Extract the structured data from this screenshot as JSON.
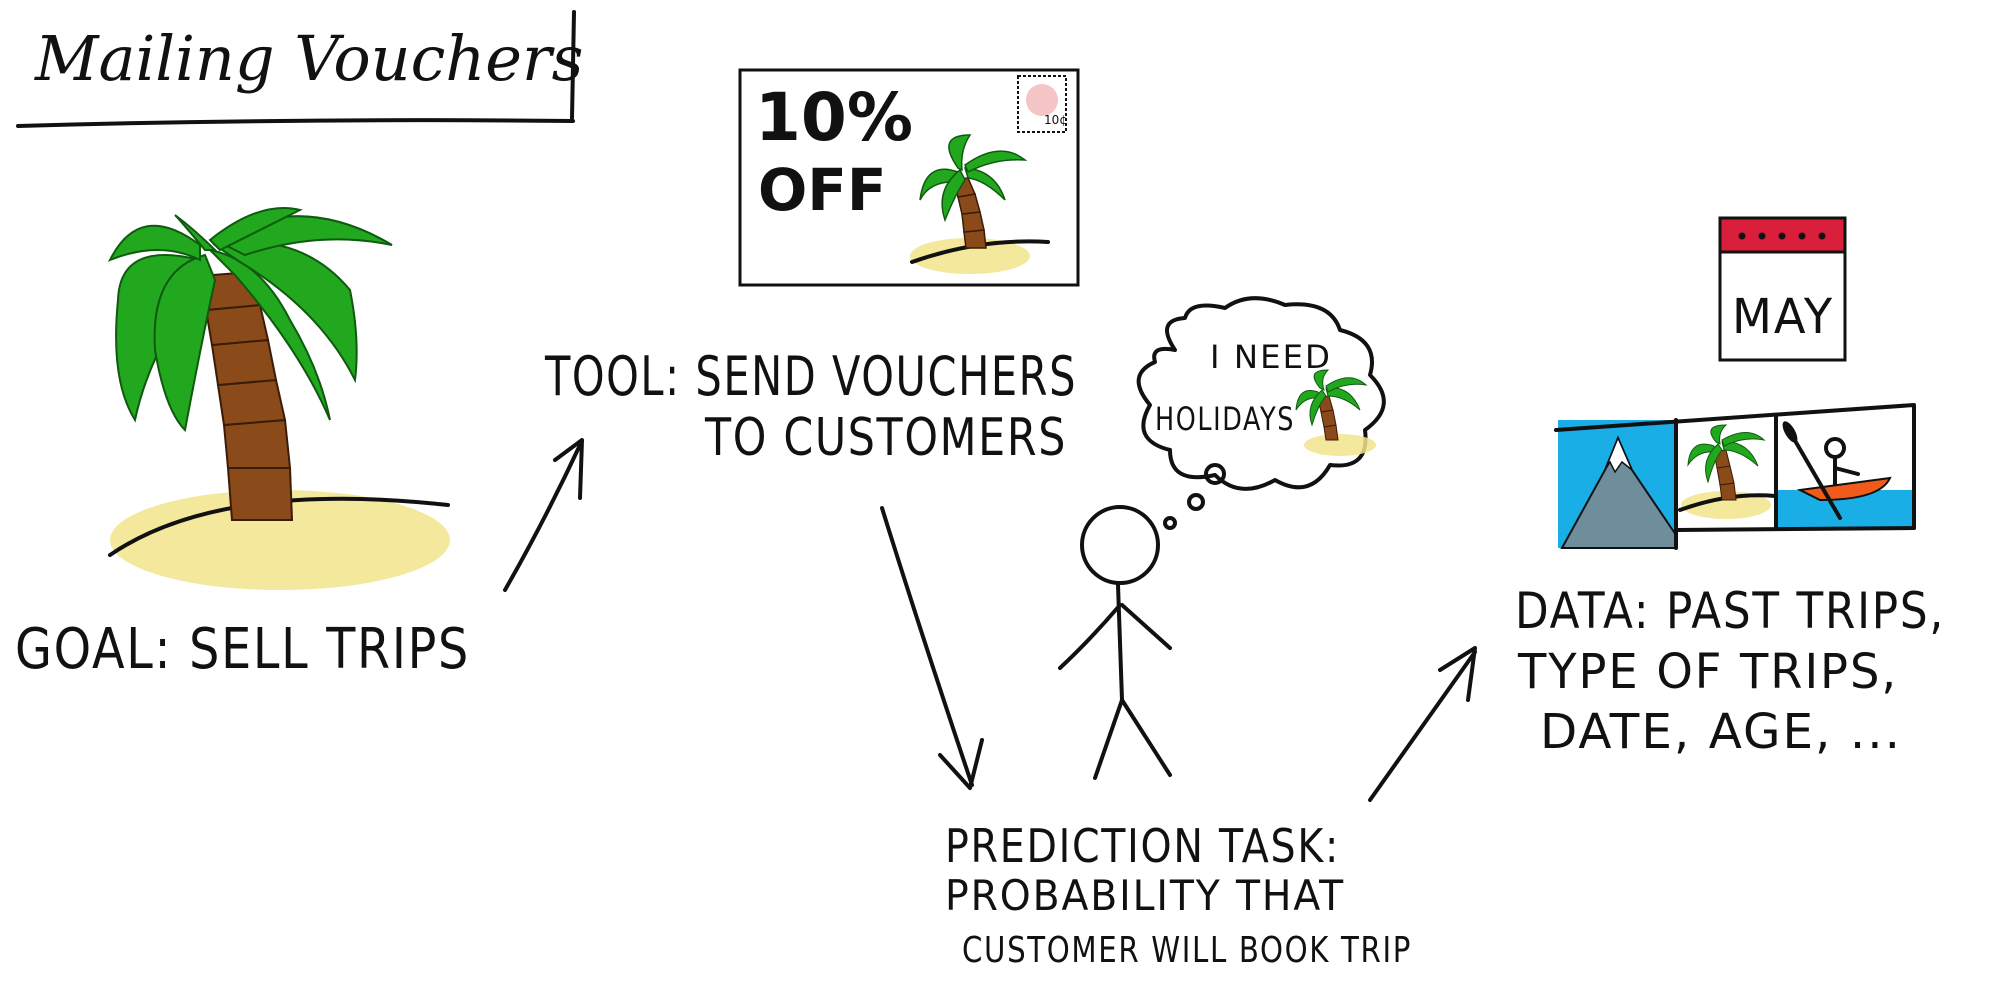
{
  "title": "Mailing Vouchers",
  "goal": {
    "label": "GOAL: SELL TRIPS"
  },
  "tool": {
    "line1": "TOOL: SEND VOUCHERS",
    "line2": "TO CUSTOMERS"
  },
  "voucher": {
    "discount": "10%",
    "off": "OFF",
    "stamp": "10¢"
  },
  "thought": {
    "line1": "I NEED",
    "line2": "HOLIDAYS"
  },
  "calendar": {
    "month": "MAY"
  },
  "data": {
    "line1": "DATA: PAST TRIPS,",
    "line2": "TYPE OF TRIPS,",
    "line3": "DATE, AGE, ..."
  },
  "prediction": {
    "line1": "PREDICTION TASK:",
    "line2": "PROBABILITY THAT",
    "line3": "CUSTOMER WILL BOOK TRIP"
  },
  "colors": {
    "palm_leaf": "#22a81e",
    "palm_trunk": "#8b4a1a",
    "sand": "#f1e48a",
    "sky": "#1aaee6",
    "mountain": "#6f8e9c",
    "calendar_header": "#d91e3c",
    "kayak": "#f05a1a"
  }
}
